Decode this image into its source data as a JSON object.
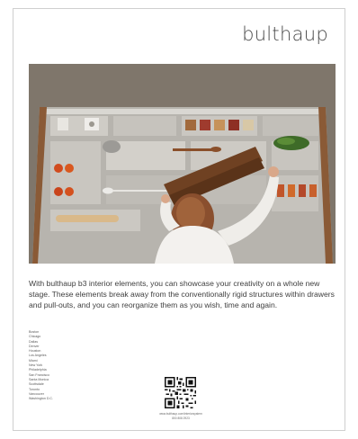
{
  "brand": {
    "name": "bulthaup"
  },
  "body_text": "With bulthaup b3 interior elements, you can showcase your creativity on a whole new stage. These elements break away from the conventionally rigid structures within drawers and pull-outs, and you can reorganize them as you wish, time and again.",
  "cities": [
    "Boston",
    "Chicago",
    "Dallas",
    "Denver",
    "Houston",
    "Los Angeles",
    "Miami",
    "New York",
    "Philadelphia",
    "San Francisco",
    "Santa Monica",
    "Scottsdale",
    "Toronto",
    "Vancouver",
    "Washington D.C."
  ],
  "contact": {
    "url": "www.bulthaup.com/interiorsystem",
    "phone": "800 808 2923"
  }
}
